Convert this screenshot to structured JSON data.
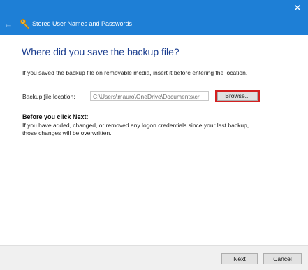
{
  "window": {
    "title": "Stored User Names and Passwords",
    "close_glyph": "✕",
    "back_glyph": "←",
    "titlebar_color": "#1e7fd6"
  },
  "icons": {
    "title_icon": "key-icon",
    "back": "back-arrow-icon",
    "close": "close-icon"
  },
  "main": {
    "heading": "Where did you save the backup file?",
    "intro": "If you saved the backup file on removable media, insert it before entering the location.",
    "location_label_pre": "Backup ",
    "location_label_ul": "f",
    "location_label_post": "ile location:",
    "location_value": "C:\\Users\\mauro\\OneDrive\\Documents\\cr",
    "browse_label_pre": "",
    "browse_label_ul": "B",
    "browse_label_post": "rowse...",
    "before_title": "Before you click Next:",
    "before_text": "If you have added, changed, or removed any logon credentials since your last backup, those changes will be overwritten.",
    "highlight_color": "#d32020"
  },
  "footer": {
    "next_label_ul": "N",
    "next_label_post": "ext",
    "cancel_label": "Cancel"
  }
}
